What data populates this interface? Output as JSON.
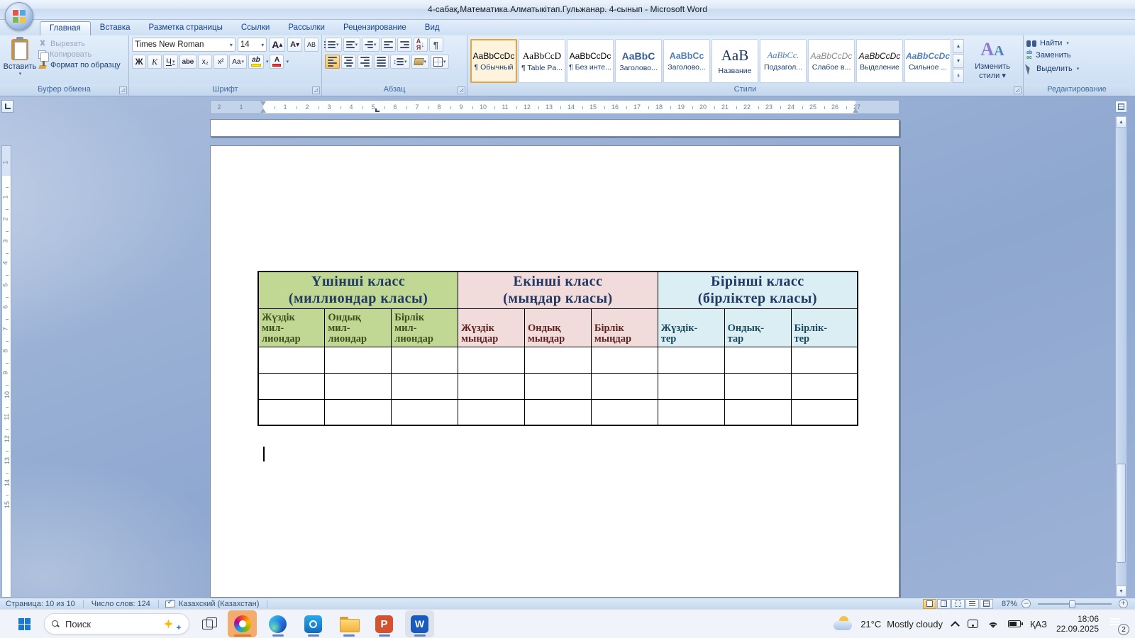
{
  "window": {
    "title": "4-сабақ,Математика.Алматыкітап.Гульжанар. 4-сынып   - Microsoft Word"
  },
  "ribbon": {
    "tabs": [
      {
        "label": "Главная",
        "active": true
      },
      {
        "label": "Вставка",
        "active": false
      },
      {
        "label": "Разметка страницы",
        "active": false
      },
      {
        "label": "Ссылки",
        "active": false
      },
      {
        "label": "Рассылки",
        "active": false
      },
      {
        "label": "Рецензирование",
        "active": false
      },
      {
        "label": "Вид",
        "active": false
      }
    ],
    "clipboard": {
      "group_label": "Буфер обмена",
      "paste": "Вставить",
      "cut": "Вырезать",
      "copy": "Копировать",
      "format_painter": "Формат по образцу"
    },
    "font": {
      "group_label": "Шрифт",
      "font_name": "Times New Roman",
      "font_size": "14",
      "bold": "Ж",
      "italic": "K",
      "underline": "Ч",
      "strike": "abe",
      "subscript": "x₂",
      "superscript": "x²",
      "change_case": "Aa",
      "grow": "А",
      "shrink": "А",
      "clear": "АВ",
      "highlight_ab": "ab",
      "color_a": "А"
    },
    "paragraph": {
      "group_label": "Абзац",
      "sort_top": "А",
      "sort_arrow": "↓",
      "sort_bottom": "Я",
      "pilcrow": "¶"
    },
    "styles": {
      "group_label": "Стили",
      "change_styles": "Изменить стили ▾",
      "items": [
        {
          "sample": "AaBbCcDc",
          "label": "¶ Обычный",
          "kind": "sm-normal",
          "selected": true
        },
        {
          "sample": "AaBbCcD",
          "label": "¶ Table Pa...",
          "kind": "sm-table",
          "selected": false
        },
        {
          "sample": "AaBbCcDc",
          "label": "¶ Без инте...",
          "kind": "sm-normal",
          "selected": false
        },
        {
          "sample": "AaBbC",
          "label": "Заголово...",
          "kind": "sm-h1",
          "selected": false
        },
        {
          "sample": "AaBbCc",
          "label": "Заголово...",
          "kind": "sm-h2",
          "selected": false
        },
        {
          "sample": "AaB",
          "label": "Название",
          "kind": "sm-title",
          "selected": false
        },
        {
          "sample": "AaBbCc.",
          "label": "Подзагол...",
          "kind": "sm-sub",
          "selected": false
        },
        {
          "sample": "AaBbCcDc",
          "label": "Слабое в...",
          "kind": "sm-subtle",
          "selected": false
        },
        {
          "sample": "AaBbCcDc",
          "label": "Выделение",
          "kind": "sm-emph",
          "selected": false
        },
        {
          "sample": "AaBbCcDc",
          "label": "Сильное ...",
          "kind": "sm-strong",
          "selected": false
        }
      ]
    },
    "editing": {
      "group_label": "Редактирование",
      "find": "Найти",
      "replace": "Заменить",
      "select": "Выделить"
    }
  },
  "ruler": {
    "h_pre_numbers": [
      "2",
      "1"
    ],
    "h_main_count": 27,
    "v_pre_numbers": [
      "1"
    ],
    "v_main_count": 15
  },
  "document": {
    "table": {
      "classes": [
        {
          "title": "Үшінші  класс\n(миллиондар класы)",
          "bg": "#c0d893",
          "sub_color": "#3f4d1d",
          "cols": [
            "Жүздік\nмил-\nлиондар",
            "Ондық\nмил-\nлиондар",
            "Бірлік\nмил-\nлиондар"
          ]
        },
        {
          "title": "Екінші  класс\n(мыңдар класы)",
          "bg": "#f2dbdb",
          "sub_color": "#5e2323",
          "cols": [
            "Жүздік\nмыңдар",
            "Ондық\nмыңдар",
            "Бірлік\nмыңдар"
          ]
        },
        {
          "title": "Бірінші  класс\n(бірліктер класы)",
          "bg": "#daeef3",
          "sub_color": "#1c4a5e",
          "cols": [
            "Жүздік-\nтер",
            "Ондық-\nтар",
            "Бірлік-\nтер"
          ]
        }
      ],
      "title_color": "#1f3864",
      "empty_row_count": 3
    }
  },
  "status": {
    "page": "Страница: 10 из 10",
    "words": "Число слов: 124",
    "language": "Казахский (Казахстан)",
    "zoom": "87%",
    "zoom_out": "–",
    "zoom_in": "+"
  },
  "taskbar": {
    "search_placeholder": "Поиск",
    "apps": [
      {
        "name": "copilot"
      },
      {
        "name": "edge"
      },
      {
        "name": "outlook"
      },
      {
        "name": "explorer"
      },
      {
        "name": "powerpoint",
        "glyph": "P"
      },
      {
        "name": "word",
        "glyph": "W",
        "active": true
      }
    ],
    "weather_temp": "21°C",
    "weather_desc": "Mostly cloudy",
    "language": "ҚАЗ",
    "time": "18:06",
    "date": "22.09.2025",
    "notification_count": "2"
  }
}
